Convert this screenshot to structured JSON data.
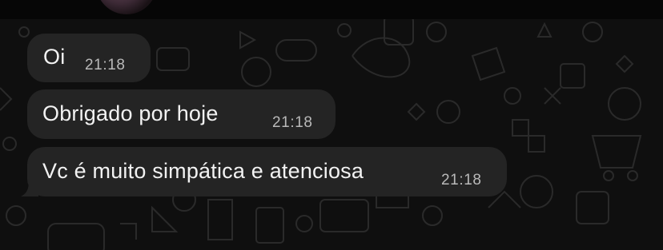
{
  "chat": {
    "messages": [
      {
        "text": "Oi",
        "time": "21:18"
      },
      {
        "text": "Obrigado por hoje",
        "time": "21:18"
      },
      {
        "text": "Vc é muito simpática e atenciosa",
        "time": "21:18"
      }
    ]
  },
  "colors": {
    "background": "#0f0f0f",
    "bubble": "#242424",
    "text": "#f2f2f2",
    "timestamp": "#b9b9b9"
  }
}
